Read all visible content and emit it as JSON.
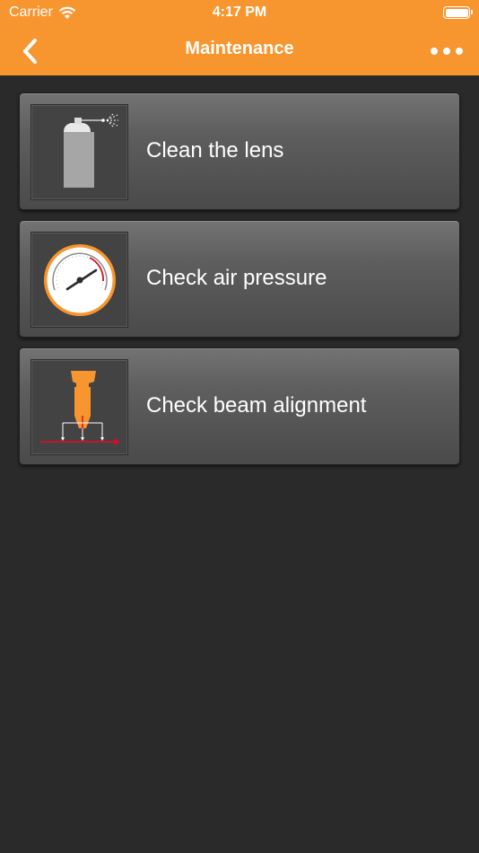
{
  "status_bar": {
    "carrier": "Carrier",
    "time": "4:17 PM"
  },
  "nav": {
    "title": "Maintenance",
    "back_icon": "chevron-left-icon",
    "more_icon": "ellipsis-icon"
  },
  "items": [
    {
      "label": "Clean the lens",
      "icon": "spray-can-icon"
    },
    {
      "label": "Check air pressure",
      "icon": "pressure-gauge-icon"
    },
    {
      "label": "Check beam alignment",
      "icon": "laser-nozzle-icon"
    }
  ],
  "colors": {
    "accent": "#f7962f",
    "background": "#2a2a2a",
    "card": "#5e5e5e",
    "laser": "#d0102a"
  }
}
